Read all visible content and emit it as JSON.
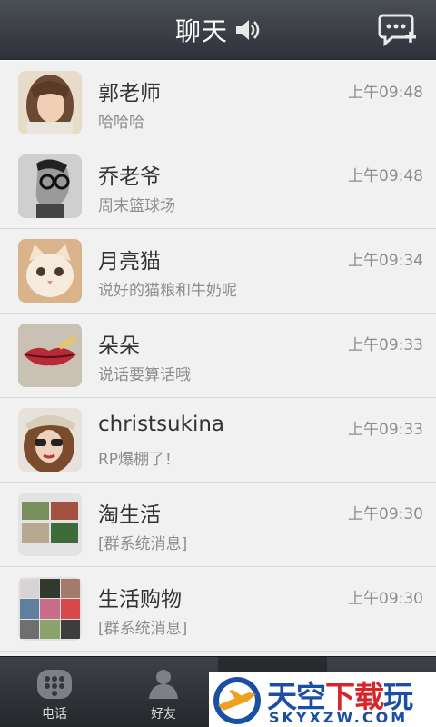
{
  "header": {
    "title": "聊天",
    "speaker_icon": "speaker-icon",
    "new_chat_icon": "new-chat-icon"
  },
  "conversations": [
    {
      "name": "郭老师",
      "message": "哈哈哈",
      "time": "上午09:48",
      "avatar": "girl-portrait"
    },
    {
      "name": "乔老爷",
      "message": "周末篮球场",
      "time": "上午09:48",
      "avatar": "man-glasses-sketch"
    },
    {
      "name": "月亮猫",
      "message": "说好的猫粮和牛奶呢",
      "time": "上午09:34",
      "avatar": "kitten"
    },
    {
      "name": "朵朵",
      "message": "说话要算话哦",
      "time": "上午09:33",
      "avatar": "lips"
    },
    {
      "name": "christsukina",
      "message": "RP爆棚了！",
      "time": "上午09:33",
      "avatar": "woman-sunglasses"
    },
    {
      "name": "淘生活",
      "message": "[群系统消息]",
      "time": "上午09:30",
      "avatar": "group-collage"
    },
    {
      "name": "生活购物",
      "message": "[群系统消息]",
      "time": "上午09:30",
      "avatar": "group-collage"
    }
  ],
  "tabs": [
    {
      "label": "电话",
      "icon": "keypad-icon"
    },
    {
      "label": "好友",
      "icon": "contacts-icon"
    }
  ],
  "watermark": {
    "big_part1": "天空",
    "big_part2": "下载",
    "big_part3": "玩",
    "small": "SKYXZW.COM"
  },
  "colors": {
    "header_bg": "#3c3f45",
    "list_bg": "#f1f1f1",
    "watermark_blue": "#1b4fa3",
    "watermark_red": "#d8252a"
  }
}
